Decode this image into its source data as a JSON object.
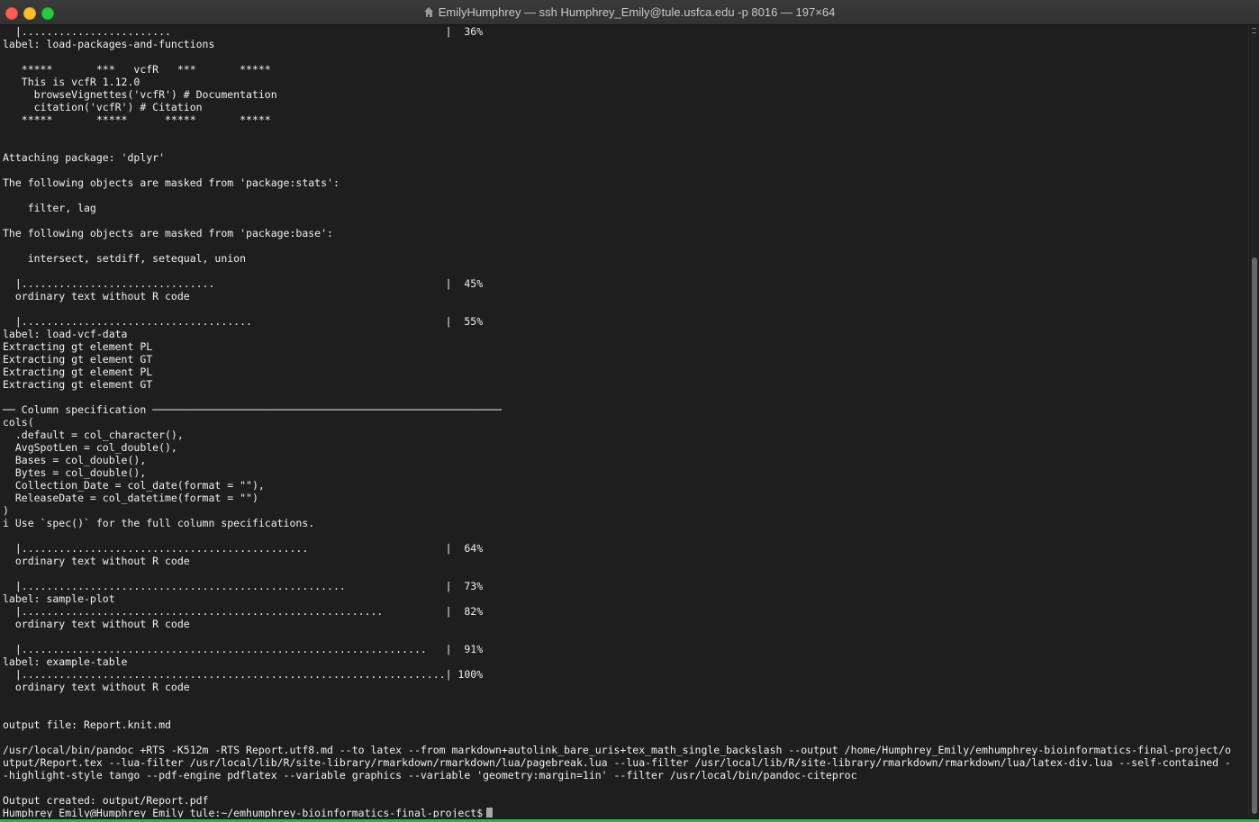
{
  "window": {
    "title": "EmilyHumphrey — ssh Humphrey_Emily@tule.usfca.edu -p 8016 — 197×64",
    "colors": {
      "close": "#fe5f57",
      "minimize": "#febc2e",
      "maximize": "#28c840",
      "background": "#1e1e1e",
      "text": "#f0f0f0",
      "status_accent": "#2bb24c"
    },
    "icons": {
      "title_icon": "home-icon"
    }
  },
  "terminal": {
    "lines": [
      "  |........................                                            |  36%",
      "label: load-packages-and-functions",
      "",
      "   *****       ***   vcfR   ***       *****",
      "   This is vcfR 1.12.0",
      "     browseVignettes('vcfR') # Documentation",
      "     citation('vcfR') # Citation",
      "   *****       *****      *****       *****",
      "",
      "",
      "Attaching package: 'dplyr'",
      "",
      "The following objects are masked from 'package:stats':",
      "",
      "    filter, lag",
      "",
      "The following objects are masked from 'package:base':",
      "",
      "    intersect, setdiff, setequal, union",
      "",
      "  |...............................                                     |  45%",
      "  ordinary text without R code",
      "",
      "  |.....................................                               |  55%",
      "label: load-vcf-data",
      "Extracting gt element PL",
      "Extracting gt element GT",
      "Extracting gt element PL",
      "Extracting gt element GT",
      "",
      "── Column specification ────────────────────────────────────────────────────────",
      "cols(",
      "  .default = col_character(),",
      "  AvgSpotLen = col_double(),",
      "  Bases = col_double(),",
      "  Bytes = col_double(),",
      "  Collection_Date = col_date(format = \"\"),",
      "  ReleaseDate = col_datetime(format = \"\")",
      ")",
      "i Use `spec()` for the full column specifications.",
      "",
      "  |..............................................                      |  64%",
      "  ordinary text without R code",
      "",
      "  |....................................................                |  73%",
      "label: sample-plot",
      "  |..........................................................          |  82%",
      "  ordinary text without R code",
      "",
      "  |.................................................................   |  91%",
      "label: example-table",
      "  |....................................................................| 100%",
      "  ordinary text without R code",
      "",
      "",
      "output file: Report.knit.md",
      "",
      "/usr/local/bin/pandoc +RTS -K512m -RTS Report.utf8.md --to latex --from markdown+autolink_bare_uris+tex_math_single_backslash --output /home/Humphrey_Emily/emhumphrey-bioinformatics-final-project/o",
      "utput/Report.tex --lua-filter /usr/local/lib/R/site-library/rmarkdown/rmarkdown/lua/pagebreak.lua --lua-filter /usr/local/lib/R/site-library/rmarkdown/rmarkdown/lua/latex-div.lua --self-contained -",
      "-highlight-style tango --pdf-engine pdflatex --variable graphics --variable 'geometry:margin=1in' --filter /usr/local/bin/pandoc-citeproc",
      "",
      "Output created: output/Report.pdf"
    ],
    "prompt": "Humphrey_Emily@Humphrey_Emily_tule:~/emhumphrey-bioinformatics-final-project$"
  }
}
